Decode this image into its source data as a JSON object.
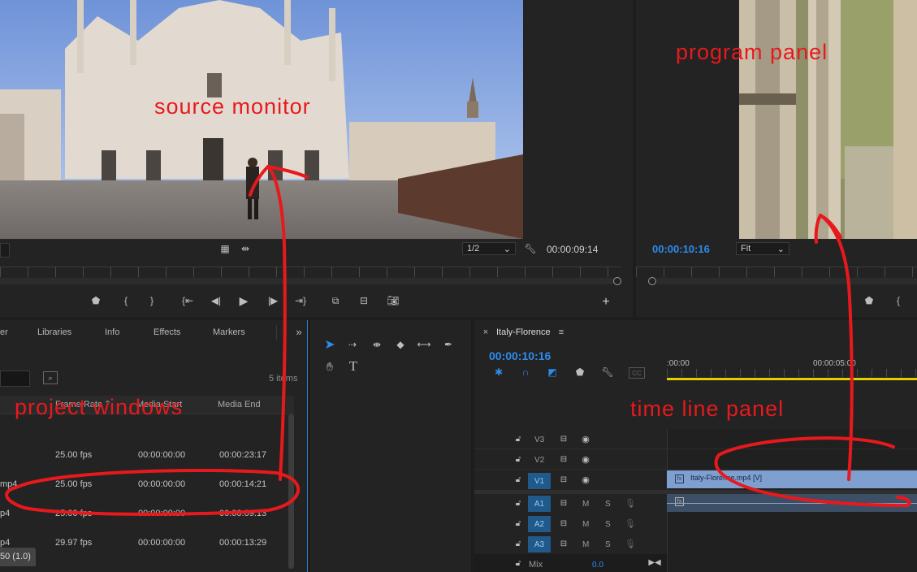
{
  "source_monitor": {
    "zoom_select": "1/2",
    "timecode": "00:00:09:14"
  },
  "program_monitor": {
    "timecode": "00:00:10:16",
    "fit_select": "Fit"
  },
  "project_panel": {
    "tabs": [
      "er",
      "Libraries",
      "Info",
      "Effects",
      "Markers"
    ],
    "item_count": "5 items",
    "columns": [
      "Frame Rate",
      "Media Start",
      "Media End"
    ],
    "rows": [
      {
        "name": "",
        "fps": "25.00 fps",
        "start": "00:00:00:00",
        "end": "00:00:23:17"
      },
      {
        "name": "mp4",
        "fps": "25.00 fps",
        "start": "00:00:00:00",
        "end": "00:00:14:21"
      },
      {
        "name": "p4",
        "fps": "25.00 fps",
        "start": "00:00:00:00",
        "end": "00:00:09:13"
      },
      {
        "name": "p4",
        "fps": "29.97 fps",
        "start": "00:00:00:00",
        "end": "00:00:13:29"
      }
    ],
    "footer": "50 (1.0)"
  },
  "timeline": {
    "sequence_name": "Italy-Florence",
    "timecode": "00:00:10:16",
    "ruler_labels": [
      ":00:00",
      "00:00:05:00"
    ],
    "video_tracks": [
      "V3",
      "V2",
      "V1"
    ],
    "audio_tracks": [
      "A1",
      "A2",
      "A3"
    ],
    "clip_label": "Italy-Florence.mp4 [V]",
    "mix_label": "Mix",
    "mix_value": "0.0"
  },
  "annotations": {
    "source_monitor": "source monitor",
    "program_panel": "program panel",
    "project_windows": "project windows",
    "time_line_panel": "time line panel"
  },
  "colors": {
    "accent_blue": "#2d8ceb",
    "annotation_red": "#e8191d",
    "clip_blue": "#7e9fcf",
    "playhead_yellow": "#e0d000"
  }
}
